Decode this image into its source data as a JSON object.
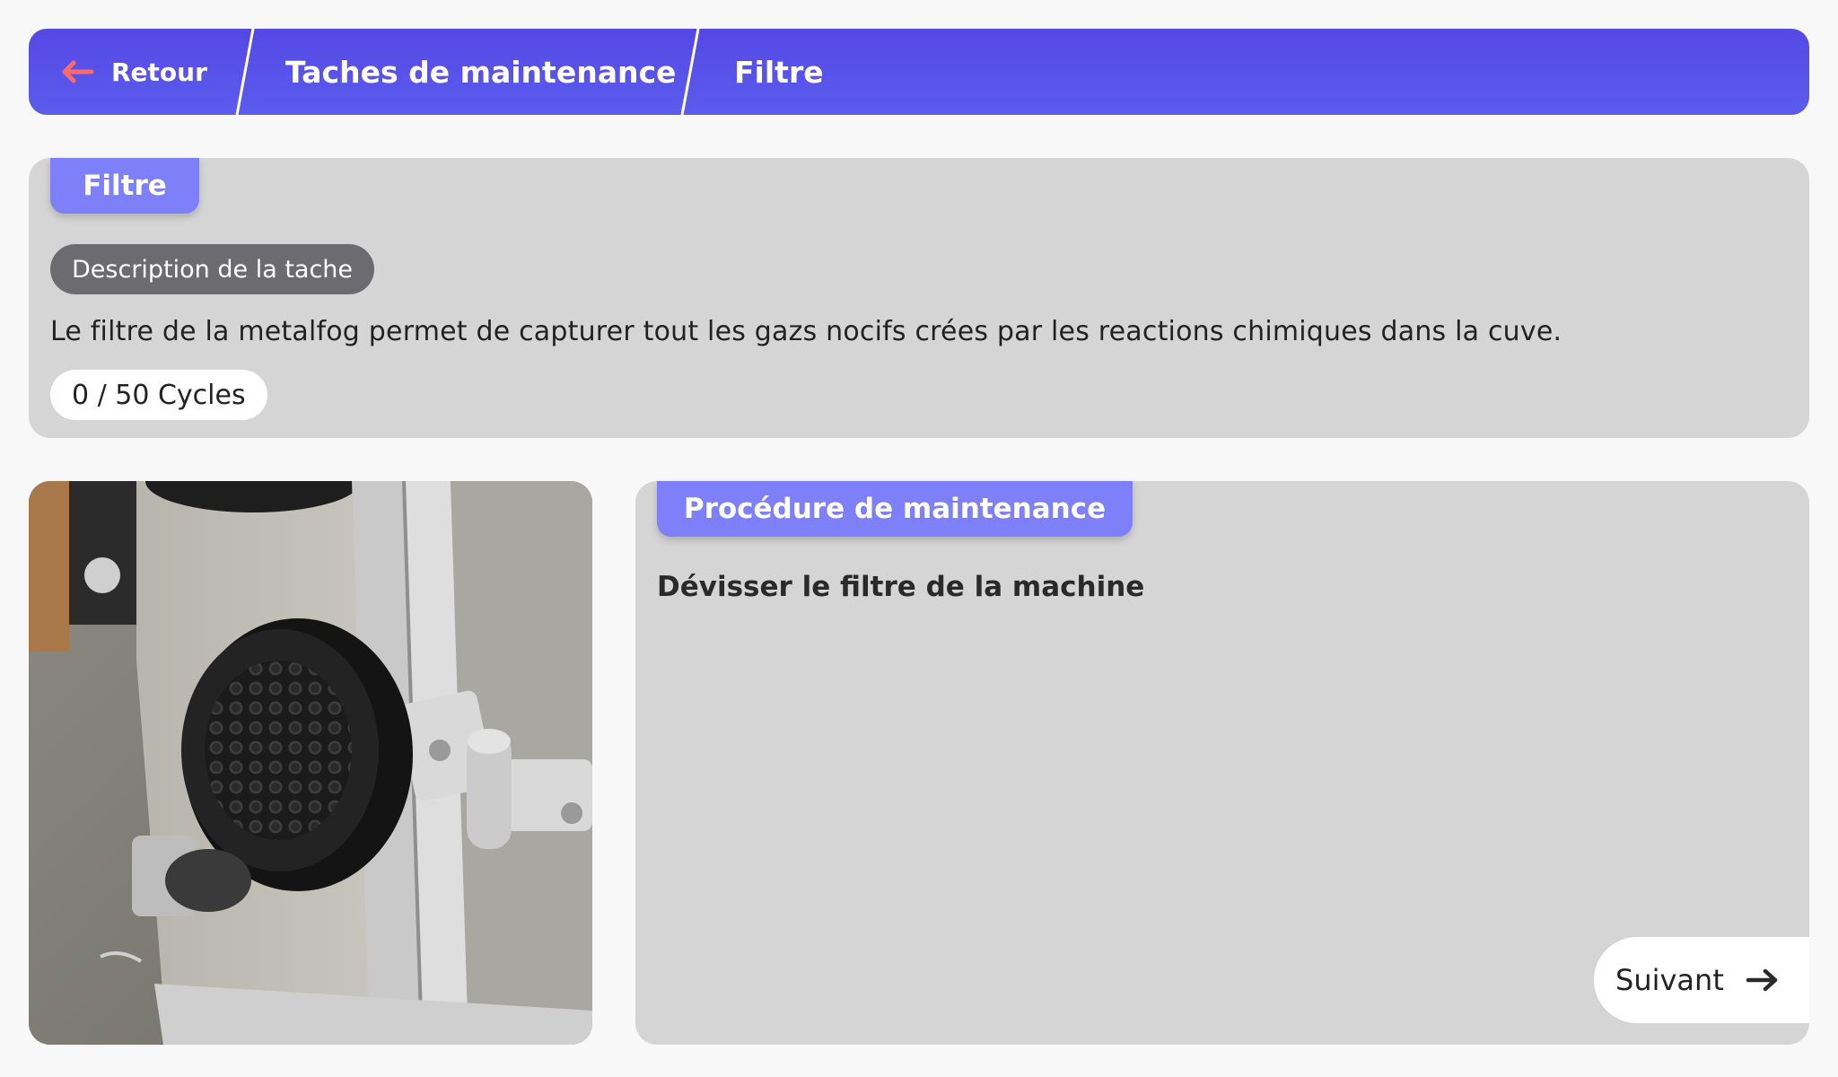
{
  "breadcrumb": {
    "back_label": "Retour",
    "tasks_label": "Taches de maintenance",
    "current_label": "Filtre",
    "accent_color": "#5548e6",
    "back_arrow_color": "#ff6b6b"
  },
  "task": {
    "tab_label": "Filtre",
    "description_header": "Description de la tache",
    "description": "Le filtre de la metalfog permet de capturer tout les gazs nocifs crées par les reactions chimiques dans la cuve.",
    "cycles": "0 / 50 Cycles"
  },
  "procedure": {
    "tab_label": "Procédure de maintenance",
    "step": "Dévisser le filtre de la machine",
    "next_label": "Suivant"
  },
  "photo": {
    "subject": "machine-filter-photo"
  }
}
